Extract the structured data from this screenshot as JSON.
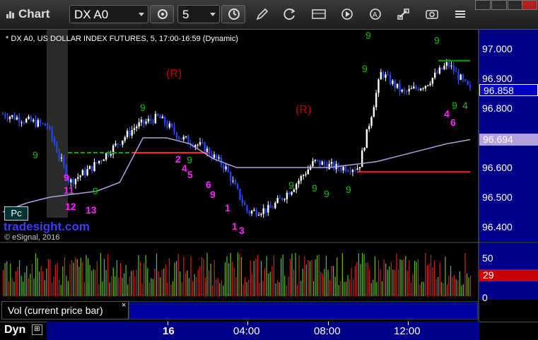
{
  "toolbar": {
    "app_title": "Chart",
    "symbol": "DX A0",
    "interval": "5"
  },
  "chart": {
    "title": "* DX A0, US DOLLAR INDEX FUTURES, 5, 17:00-16:59 (Dynamic)",
    "watermark_site": "tradesight.com",
    "watermark_esignal": "© eSignal, 2016",
    "pc_label": "Pc",
    "reversal_labels": [
      "(R)",
      "(R)"
    ],
    "count_labels": [
      "9",
      "11",
      "12",
      "13",
      "2",
      "4",
      "5",
      "6",
      "9",
      "1",
      "1",
      "3",
      "4",
      "6",
      "9",
      "9",
      "9",
      "9",
      "9",
      "9",
      "9",
      "4",
      "9",
      "9",
      "9",
      "9",
      "9"
    ]
  },
  "price_axis": {
    "labels": [
      "97.000",
      "96.900",
      "96.800",
      "96.600",
      "96.500",
      "96.400"
    ],
    "last_price": "96.858",
    "ma_price": "96.694",
    "colors": {
      "last_bg": "#0000c8",
      "ma_bg": "#b4a0dc",
      "vol_bg": "#cc0000"
    }
  },
  "volume_panel": {
    "label": "Vol (current price bar)",
    "close_symbol": "×",
    "axis_labels": [
      "50",
      "0"
    ],
    "current_value": "29"
  },
  "time_axis": {
    "dyn_label": "Dyn",
    "labels": [
      "16",
      "04:00",
      "08:00",
      "12:00"
    ]
  },
  "chart_data": {
    "type": "candlestick",
    "title": "* DX A0, US DOLLAR INDEX FUTURES, 5, 17:00-16:59 (Dynamic)",
    "ylim": [
      96.36,
      97.05
    ],
    "last_price": 96.858,
    "ma_value": 96.694,
    "levels": [
      {
        "color": "#00aa00",
        "value": 96.65,
        "style": "dashed"
      },
      {
        "color": "#ff2020",
        "value": 96.65,
        "style": "solid"
      },
      {
        "color": "#ff2020",
        "value": 96.585,
        "style": "solid"
      },
      {
        "color": "#00aa00",
        "value": 96.96,
        "style": "solid"
      }
    ],
    "price_path": [
      {
        "t": "17:00",
        "p": 96.78
      },
      {
        "t": "18:00",
        "p": 96.76
      },
      {
        "t": "19:00",
        "p": 96.74
      },
      {
        "t": "20:00",
        "p": 96.55
      },
      {
        "t": "21:00",
        "p": 96.6
      },
      {
        "t": "22:00",
        "p": 96.67
      },
      {
        "t": "23:00",
        "p": 96.74
      },
      {
        "t": "00:00",
        "p": 96.77
      },
      {
        "t": "01:00",
        "p": 96.7
      },
      {
        "t": "02:00",
        "p": 96.67
      },
      {
        "t": "03:00",
        "p": 96.6
      },
      {
        "t": "04:00",
        "p": 96.45
      },
      {
        "t": "05:00",
        "p": 96.46
      },
      {
        "t": "06:00",
        "p": 96.53
      },
      {
        "t": "07:00",
        "p": 96.62
      },
      {
        "t": "08:00",
        "p": 96.6
      },
      {
        "t": "09:00",
        "p": 96.6
      },
      {
        "t": "10:00",
        "p": 96.92
      },
      {
        "t": "11:00",
        "p": 96.85
      },
      {
        "t": "12:00",
        "p": 96.88
      },
      {
        "t": "13:00",
        "p": 96.95
      },
      {
        "t": "14:00",
        "p": 96.86
      }
    ]
  }
}
